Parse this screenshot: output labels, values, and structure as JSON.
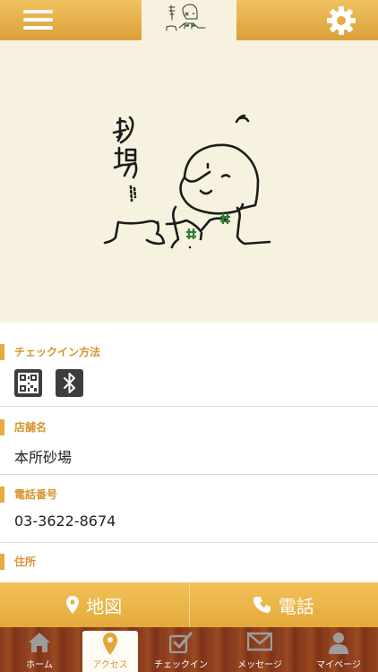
{
  "header": {
    "menu_icon": "hamburger-menu-icon",
    "settings_icon": "gear-icon",
    "logo": "sunaba-logo"
  },
  "checkin": {
    "title": "チェックイン方法",
    "methods": [
      "qr-code-icon",
      "bluetooth-icon"
    ]
  },
  "store": {
    "title": "店舗名",
    "value": "本所砂場"
  },
  "phone": {
    "title": "電話番号",
    "value": "03-3622-8674"
  },
  "address": {
    "title": "住所"
  },
  "actions": {
    "map_label": "地図",
    "call_label": "電話"
  },
  "tabs": [
    {
      "label": "ホーム",
      "icon": "home-icon"
    },
    {
      "label": "アクセス",
      "icon": "map-pin-icon"
    },
    {
      "label": "チェックイン",
      "icon": "checkin-icon"
    },
    {
      "label": "メッセージ",
      "icon": "mail-icon"
    },
    {
      "label": "マイページ",
      "icon": "user-icon"
    }
  ],
  "colors": {
    "accent": "#e8aa3c",
    "header": "#e3ad4a",
    "cream": "#f7f2df",
    "tabbar": "#8a3b1d"
  }
}
